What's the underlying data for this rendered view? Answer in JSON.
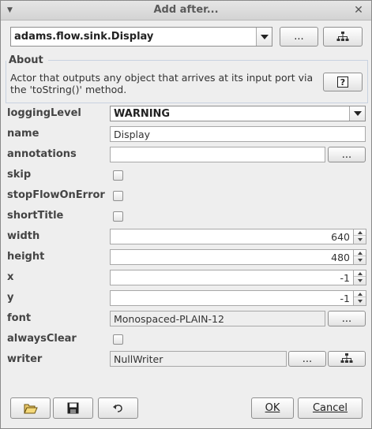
{
  "window": {
    "title": "Add after..."
  },
  "class_selector": {
    "value": "adams.flow.sink.Display",
    "browse_label": "..."
  },
  "about": {
    "legend": "About",
    "text": "Actor that outputs any object that arrives at its input port via the 'toString()' method."
  },
  "properties": {
    "loggingLevel": {
      "label": "loggingLevel",
      "value": "WARNING"
    },
    "name": {
      "label": "name",
      "value": "Display"
    },
    "annotations": {
      "label": "annotations",
      "value": "",
      "button": "..."
    },
    "skip": {
      "label": "skip",
      "checked": false
    },
    "stopFlowOnError": {
      "label": "stopFlowOnError",
      "checked": false
    },
    "shortTitle": {
      "label": "shortTitle",
      "checked": false
    },
    "width": {
      "label": "width",
      "value": "640"
    },
    "height": {
      "label": "height",
      "value": "480"
    },
    "x": {
      "label": "x",
      "value": "-1"
    },
    "y": {
      "label": "y",
      "value": "-1"
    },
    "font": {
      "label": "font",
      "value": "Monospaced-PLAIN-12",
      "button": "..."
    },
    "alwaysClear": {
      "label": "alwaysClear",
      "checked": false
    },
    "writer": {
      "label": "writer",
      "value": "NullWriter",
      "button": "..."
    }
  },
  "buttons": {
    "ok_label": "OK",
    "cancel_label": "Cancel"
  },
  "icons": {
    "menu": "menu-icon",
    "close": "close-icon",
    "tree": "tree-icon",
    "help": "help-icon",
    "open": "open-folder-icon",
    "save": "save-icon",
    "undo": "undo-icon"
  }
}
